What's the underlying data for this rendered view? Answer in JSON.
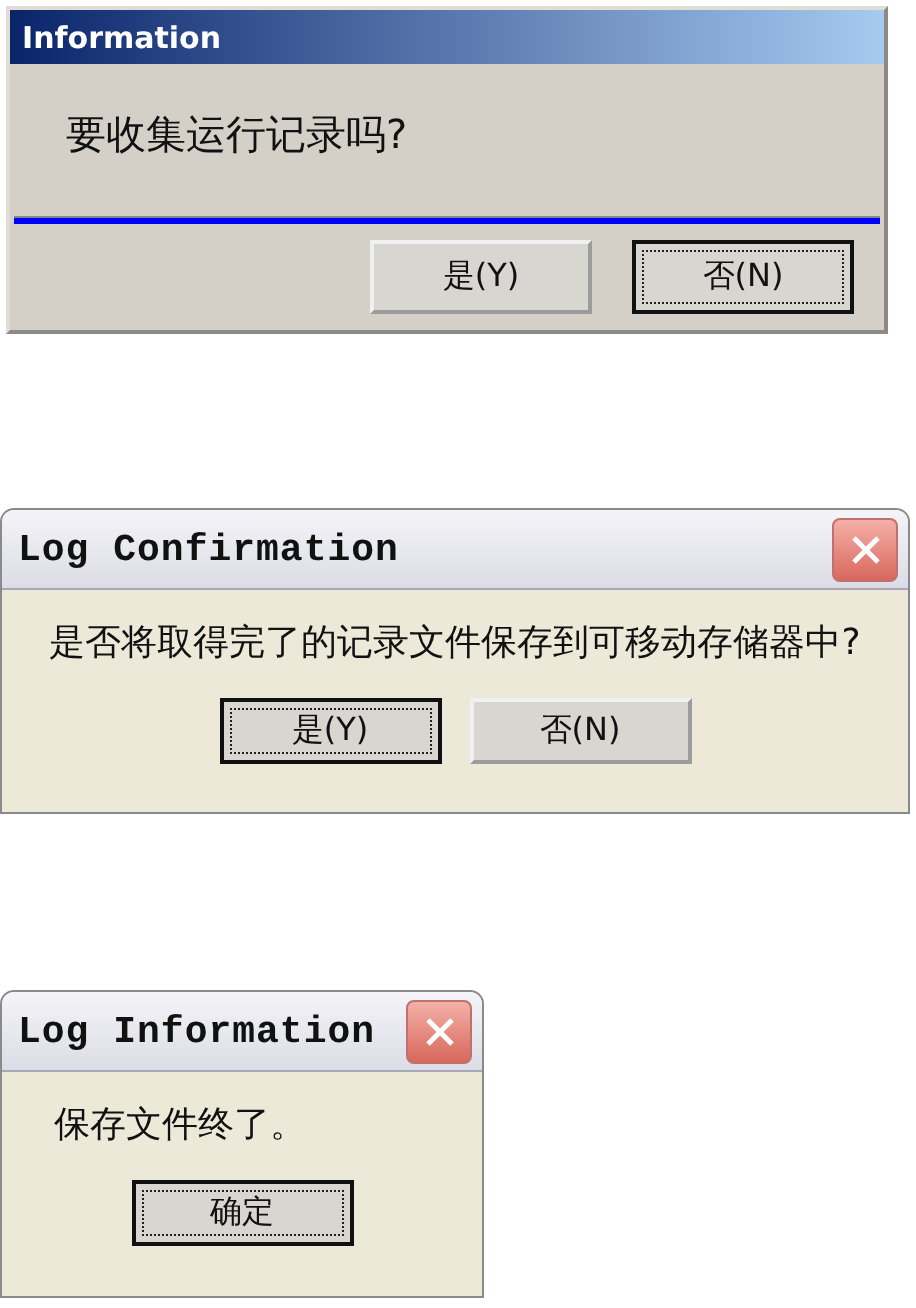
{
  "dialogs": [
    {
      "kind": "classic",
      "title": "Information",
      "message": "要收集运行记录吗?",
      "has_close": false,
      "buttons": [
        {
          "label": "是(Y)",
          "focused": false
        },
        {
          "label": "否(N)",
          "focused": true
        }
      ]
    },
    {
      "kind": "xp",
      "title": "Log Confirmation",
      "message": "是否将取得完了的记录文件保存到可移动存储器中?",
      "has_close": true,
      "buttons": [
        {
          "label": "是(Y)",
          "focused": true
        },
        {
          "label": "否(N)",
          "focused": false
        }
      ]
    },
    {
      "kind": "xp",
      "title": "Log Information",
      "message": "保存文件终了。",
      "has_close": true,
      "buttons": [
        {
          "label": "确定",
          "focused": true
        }
      ]
    }
  ]
}
